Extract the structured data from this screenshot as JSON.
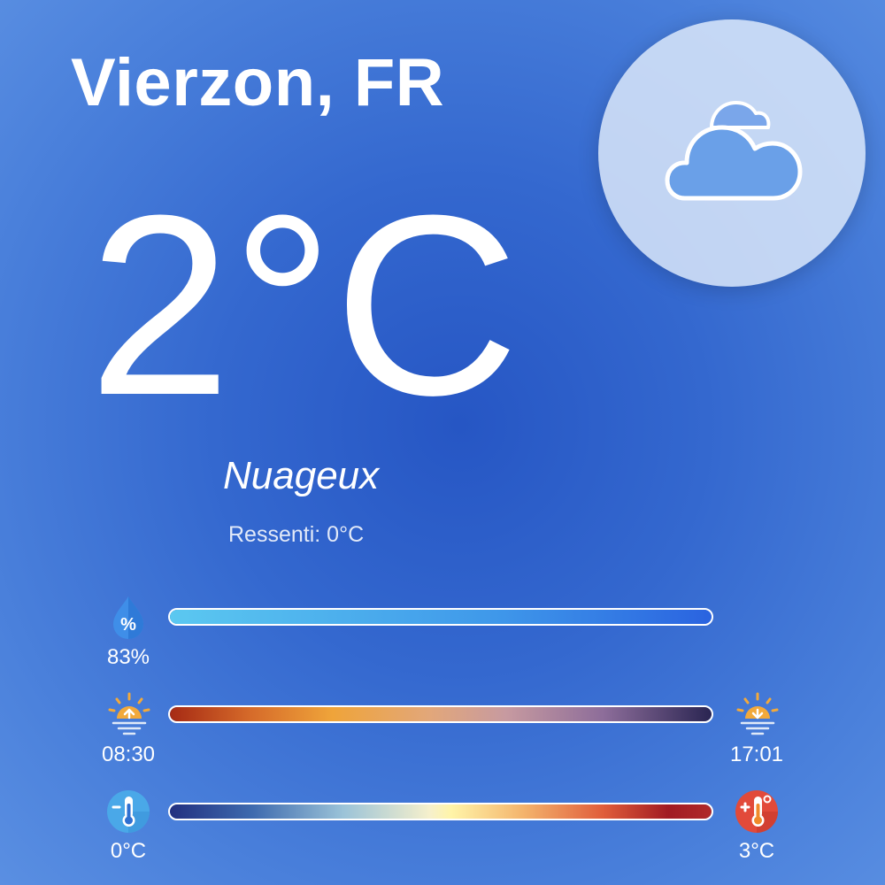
{
  "location": {
    "city": "Vierzon, FR"
  },
  "current": {
    "temperature": "2°C",
    "condition": "Nuageux",
    "feels_like_label": "Ressenti:",
    "feels_like_value": "0°C",
    "icon": "cloud-icon"
  },
  "humidity": {
    "label": "83%",
    "value": 83,
    "icon": "humidity-drop-icon"
  },
  "sun": {
    "sunrise": "08:30",
    "sunset": "17:01",
    "sunrise_icon": "sunrise-icon",
    "sunset_icon": "sunset-icon"
  },
  "temperature_range": {
    "min": "0°C",
    "max": "3°C",
    "min_icon": "thermometer-cold-icon",
    "max_icon": "thermometer-hot-icon"
  },
  "colors": {
    "background": "#3468cf",
    "humidity_bar": "#3f98ea",
    "sunrise_icon": "#f2a93b",
    "cold_icon": "#4aa8e8",
    "hot_icon": "#e24a3a"
  }
}
